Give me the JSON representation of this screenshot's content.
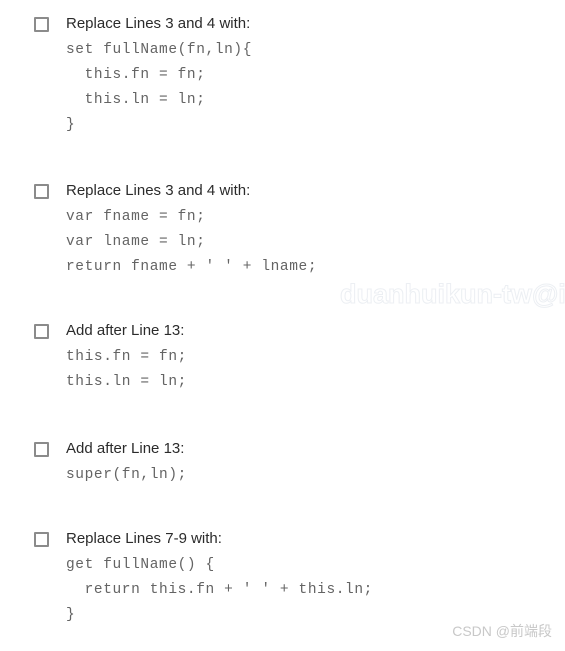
{
  "page": {
    "background_color": "#ffffff",
    "label_color": "#2b2b2b",
    "code_color": "#646464",
    "checkbox_border_color": "#8b8b8b"
  },
  "options": [
    {
      "label": "Replace Lines 3 and 4 with:",
      "code": [
        "set fullName(fn,ln){",
        "  this.fn = fn;",
        "  this.ln = ln;",
        "}"
      ]
    },
    {
      "label": "Replace Lines 3 and 4 with:",
      "code": [
        "var fname = fn;",
        "var lname = ln;",
        "return fname + ' ' + lname;"
      ]
    },
    {
      "label": "Add after Line 13:",
      "code": [
        "this.fn = fn;",
        "this.ln = ln;"
      ]
    },
    {
      "label": "Add after Line 13:",
      "code": [
        "super(fn,ln);"
      ]
    },
    {
      "label": "Replace Lines 7-9 with:",
      "code": [
        "get fullName() {",
        "  return this.fn + ' ' + this.ln;",
        "}"
      ]
    }
  ],
  "watermarks": {
    "overlay_text": "duanhuikun-tw@i",
    "footer_text": "CSDN @前端段"
  }
}
